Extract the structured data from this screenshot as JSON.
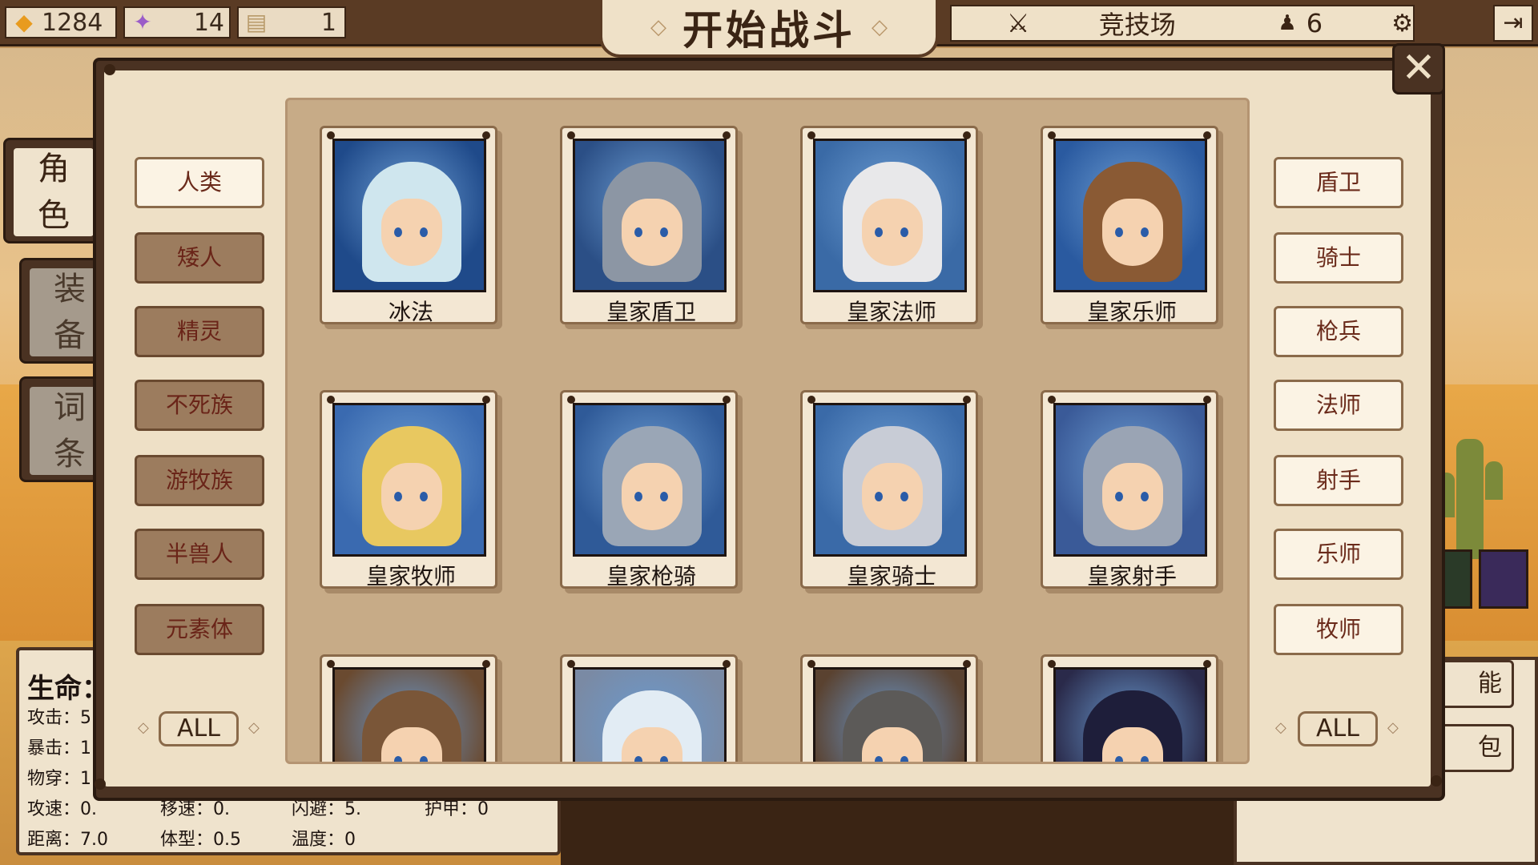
{
  "resources": {
    "gold": "1284",
    "candy": "14",
    "ticket": "1"
  },
  "top": {
    "start_title": "开始战斗",
    "arena_label": "竞技场",
    "player_count": "6"
  },
  "side_tabs": [
    {
      "char1": "角",
      "char2": "色"
    },
    {
      "char1": "装",
      "char2": "备"
    },
    {
      "char1": "词",
      "char2": "条"
    }
  ],
  "race_filters": [
    "人类",
    "矮人",
    "精灵",
    "不死族",
    "游牧族",
    "半兽人",
    "元素体"
  ],
  "active_race": "人类",
  "class_filters": [
    "盾卫",
    "骑士",
    "枪兵",
    "法师",
    "射手",
    "乐师",
    "牧师"
  ],
  "all_label": "ALL",
  "heroes": [
    {
      "name": "冰法",
      "bg": "#1f4a8a",
      "hair": "#cfe6ee"
    },
    {
      "name": "皇家盾卫",
      "bg": "#2b4f86",
      "hair": "#8c96a4"
    },
    {
      "name": "皇家法师",
      "bg": "#3a6aa6",
      "hair": "#e8e8ea"
    },
    {
      "name": "皇家乐师",
      "bg": "#2a5aa0",
      "hair": "#8a5a34"
    },
    {
      "name": "皇家牧师",
      "bg": "#3a6ab0",
      "hair": "#e8c860"
    },
    {
      "name": "皇家枪骑",
      "bg": "#2f5a98",
      "hair": "#9aa6b6"
    },
    {
      "name": "皇家骑士",
      "bg": "#3a6aa8",
      "hair": "#c8ccd6"
    },
    {
      "name": "皇家射手",
      "bg": "#3a5a98",
      "hair": "#9aa4b4"
    },
    {
      "name": "",
      "bg": "#6a4a30",
      "hair": "#7a5638"
    },
    {
      "name": "",
      "bg": "#7a8aa4",
      "hair": "#e2ecf4"
    },
    {
      "name": "",
      "bg": "#5a4230",
      "hair": "#5c5a58"
    },
    {
      "name": "",
      "bg": "#2a2a4a",
      "hair": "#1e1e3a"
    }
  ],
  "stats": {
    "hp_label": "生命：",
    "atk": "攻击：5",
    "crit": "暴击：1",
    "pierce": "物穿：1",
    "speed": "攻速：0.",
    "move": "移速：0.",
    "dodge": "闪避：5.",
    "armor": "护甲：0",
    "range": "距离：7.0",
    "size": "体型：0.5",
    "temp": "温度：0"
  },
  "right_buttons": {
    "skill": "能",
    "bag": "包"
  },
  "colors": {
    "accent": "#4a3222",
    "panel": "#eee0c6",
    "active_text": "#6a2a1a"
  }
}
